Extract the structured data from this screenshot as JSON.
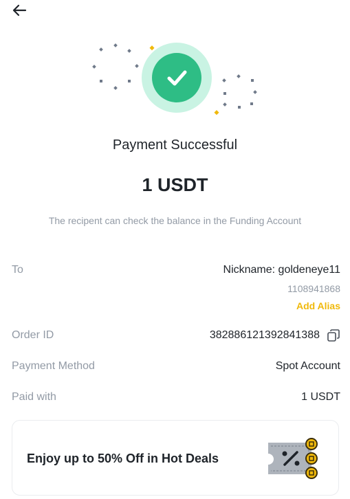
{
  "header": {
    "back_icon": "arrow-left-icon"
  },
  "status": {
    "icon": "check-circle-icon",
    "accent_color": "#2ebd85",
    "title": "Payment Successful",
    "amount": "1 USDT",
    "subtitle": "The recipent can check the balance in the Funding Account"
  },
  "details": {
    "to": {
      "label": "To",
      "nickname": "Nickname: goldeneye11",
      "user_id": "1108941868",
      "add_alias": "Add Alias"
    },
    "order": {
      "label": "Order ID",
      "value": "382886121392841388",
      "copy_icon": "copy-icon"
    },
    "payment_method": {
      "label": "Payment Method",
      "value": "Spot Account"
    },
    "paid_with": {
      "label": "Paid with",
      "value": "1 USDT"
    }
  },
  "promo": {
    "text": "Enjoy up to 50% Off in Hot Deals",
    "icon": "discount-ticket-icon",
    "brand_color": "#f0b90b"
  }
}
